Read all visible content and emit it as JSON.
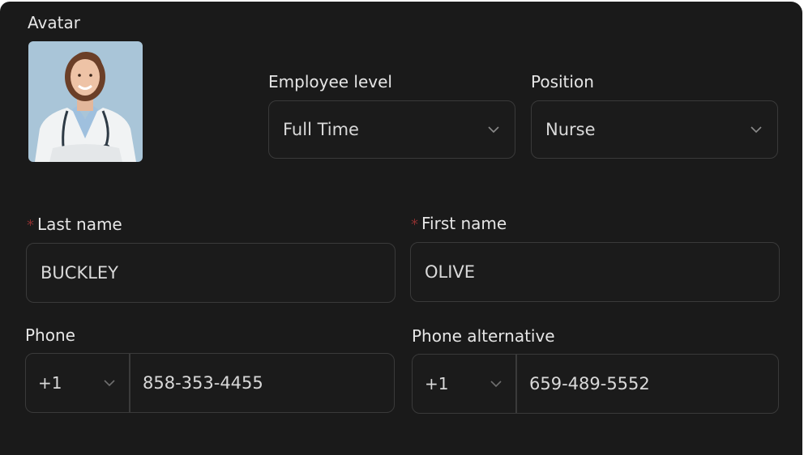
{
  "avatar": {
    "label": "Avatar"
  },
  "employee_level": {
    "label": "Employee level",
    "value": "Full Time"
  },
  "position": {
    "label": "Position",
    "value": "Nurse"
  },
  "last_name": {
    "required_mark": "*",
    "label": "Last name",
    "value": "BUCKLEY"
  },
  "first_name": {
    "required_mark": "*",
    "label": "First name",
    "value": "OLIVE"
  },
  "phone": {
    "label": "Phone",
    "country_code": "+1",
    "number": "858-353-4455"
  },
  "phone_alternative": {
    "label": "Phone alternative",
    "country_code": "+1",
    "number": "659-489-5552"
  },
  "colors": {
    "background": "#1a1a1a",
    "border": "#3a3a3a",
    "required": "#8a2f2f",
    "text": "#e6e6e6"
  }
}
